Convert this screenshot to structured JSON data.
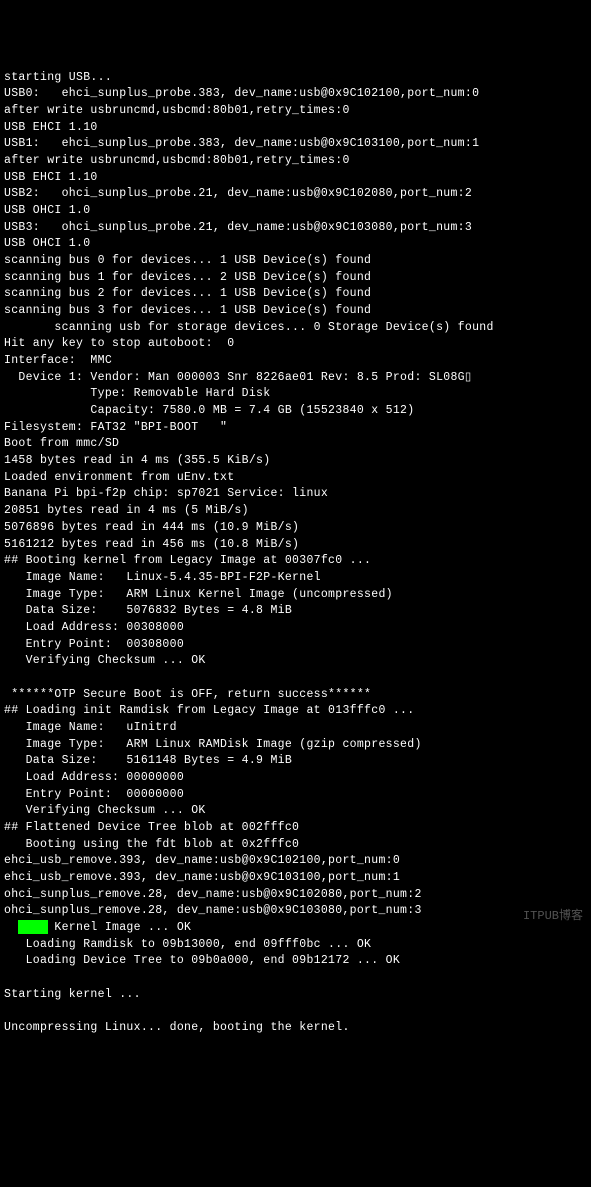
{
  "lines": [
    "starting USB...",
    "USB0:   ehci_sunplus_probe.383, dev_name:usb@0x9C102100,port_num:0",
    "after write usbruncmd,usbcmd:80b01,retry_times:0",
    "USB EHCI 1.10",
    "USB1:   ehci_sunplus_probe.383, dev_name:usb@0x9C103100,port_num:1",
    "after write usbruncmd,usbcmd:80b01,retry_times:0",
    "USB EHCI 1.10",
    "USB2:   ohci_sunplus_probe.21, dev_name:usb@0x9C102080,port_num:2",
    "USB OHCI 1.0",
    "USB3:   ohci_sunplus_probe.21, dev_name:usb@0x9C103080,port_num:3",
    "USB OHCI 1.0",
    "scanning bus 0 for devices... 1 USB Device(s) found",
    "scanning bus 1 for devices... 2 USB Device(s) found",
    "scanning bus 2 for devices... 1 USB Device(s) found",
    "scanning bus 3 for devices... 1 USB Device(s) found",
    "       scanning usb for storage devices... 0 Storage Device(s) found",
    "Hit any key to stop autoboot:  0",
    "Interface:  MMC",
    "  Device 1: Vendor: Man 000003 Snr 8226ae01 Rev: 8.5 Prod: SL08G▯",
    "            Type: Removable Hard Disk",
    "            Capacity: 7580.0 MB = 7.4 GB (15523840 x 512)",
    "Filesystem: FAT32 \"BPI-BOOT   \"",
    "Boot from mmc/SD",
    "1458 bytes read in 4 ms (355.5 KiB/s)",
    "Loaded environment from uEnv.txt",
    "Banana Pi bpi-f2p chip: sp7021 Service: linux",
    "20851 bytes read in 4 ms (5 MiB/s)",
    "5076896 bytes read in 444 ms (10.9 MiB/s)",
    "5161212 bytes read in 456 ms (10.8 MiB/s)",
    "## Booting kernel from Legacy Image at 00307fc0 ...",
    "   Image Name:   Linux-5.4.35-BPI-F2P-Kernel",
    "   Image Type:   ARM Linux Kernel Image (uncompressed)",
    "   Data Size:    5076832 Bytes = 4.8 MiB",
    "   Load Address: 00308000",
    "   Entry Point:  00308000",
    "   Verifying Checksum ... OK",
    "",
    " ******OTP Secure Boot is OFF, return success******",
    "## Loading init Ramdisk from Legacy Image at 013fffc0 ...",
    "   Image Name:   uInitrd",
    "   Image Type:   ARM Linux RAMDisk Image (gzip compressed)",
    "   Data Size:    5161148 Bytes = 4.9 MiB",
    "   Load Address: 00000000",
    "   Entry Point:  00000000",
    "   Verifying Checksum ... OK",
    "## Flattened Device Tree blob at 002fffc0",
    "   Booting using the fdt blob at 0x2fffc0",
    "ehci_usb_remove.393, dev_name:usb@0x9C102100,port_num:0",
    "ehci_usb_remove.393, dev_name:usb@0x9C103100,port_num:1",
    "ohci_sunplus_remove.28, dev_name:usb@0x9C102080,port_num:2",
    "ohci_sunplus_remove.28, dev_name:usb@0x9C103080,port_num:3",
    "   XIP Kernel Image ... OK",
    "   Loading Ramdisk to 09b13000, end 09fff0bc ... OK",
    "   Loading Device Tree to 09b0a000, end 09b12172 ... OK",
    "",
    "Starting kernel ...",
    "",
    "Uncompressing Linux... done, booting the kernel."
  ],
  "watermark": "ITPUB博客"
}
